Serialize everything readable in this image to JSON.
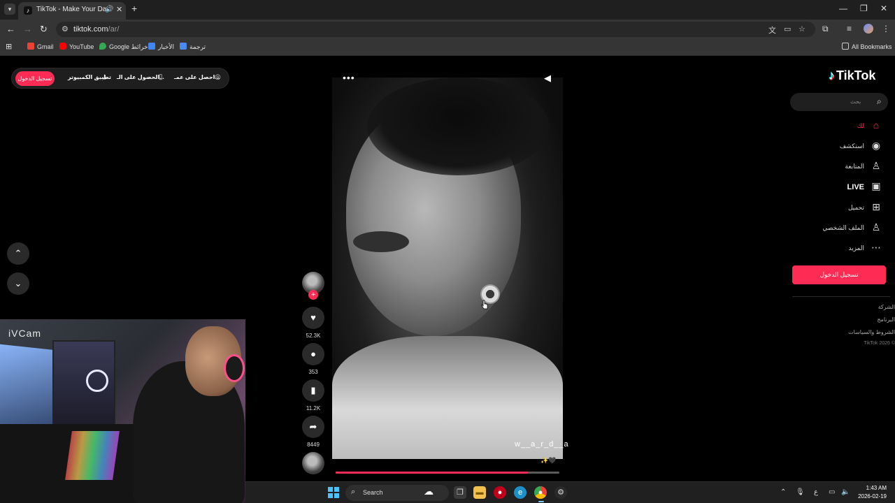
{
  "browser": {
    "tab_title": "TikTok - Make Your Day",
    "url_host": "tiktok.com",
    "url_path": "/ar/",
    "bookmarks": [
      "Gmail",
      "YouTube",
      "Google خرائط",
      "الأخبار",
      "ترجمة"
    ],
    "all_bookmarks": "All Bookmarks"
  },
  "topbar": {
    "login": "تسجيل الدخول",
    "desktop_app": "تطبيق الكمبيوتر",
    "get_app": "الحصول على الـ...",
    "get_coins": "احصل على عمـ..."
  },
  "sidebar": {
    "logo": "TikTok",
    "search_placeholder": "بحث",
    "nav": [
      {
        "label": "لك",
        "icon": "home-icon"
      },
      {
        "label": "استكشف",
        "icon": "compass-icon"
      },
      {
        "label": "المتابعة",
        "icon": "following-icon"
      },
      {
        "label": "LIVE",
        "icon": "live-icon"
      },
      {
        "label": "تحميل",
        "icon": "upload-icon"
      },
      {
        "label": "الملف الشخصي",
        "icon": "profile-icon"
      },
      {
        "label": "المزيد",
        "icon": "more-icon"
      }
    ],
    "login_button": "تسجيل الدخول",
    "footer": [
      "الشركة",
      "البرنامج",
      "الشروط والسياسات"
    ],
    "copyright": "TikTok 2026 ©"
  },
  "video": {
    "username": "w__a_r_d__a",
    "caption_emoji": "✨🖤",
    "progress": 0.86,
    "likes": "52.3K",
    "comments": "353",
    "saves": "11.2K",
    "shares": "8449"
  },
  "webcam": {
    "label": "iVCam"
  },
  "taskbar": {
    "search": "Search",
    "lang": "ع",
    "time": "1:43 AM",
    "date": "2026-02-19"
  },
  "colors": {
    "accent": "#fe2c55",
    "chrome_dark": "#1f1f1f",
    "chrome_toolbar": "#353535"
  }
}
